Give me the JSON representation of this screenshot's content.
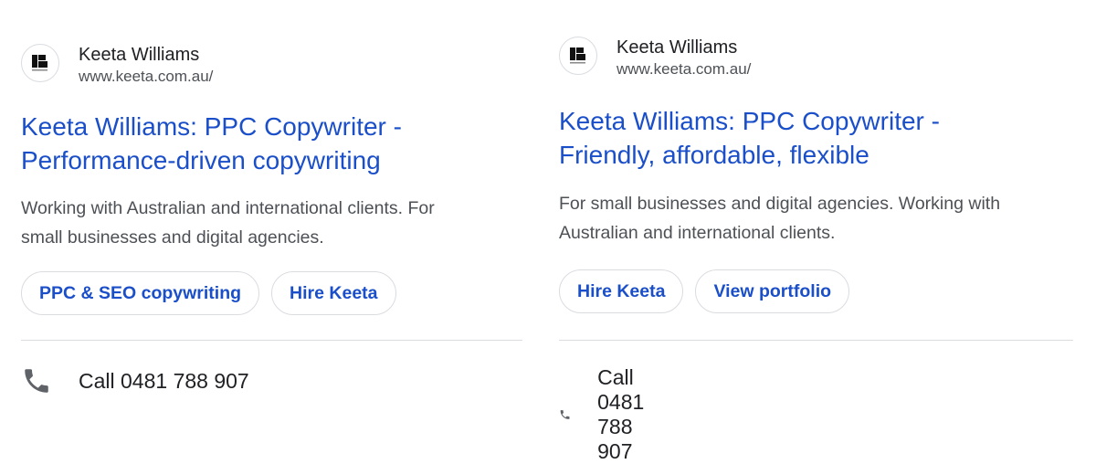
{
  "ads": [
    {
      "advertiser": "Keeta Williams",
      "url": "www.keeta.com.au/",
      "headline_line1": "Keeta Williams: PPC Copywriter -",
      "headline_line2": "Performance-driven copywriting",
      "description_line1": "Working with Australian and international clients. For",
      "description_line2": "small businesses and digital agencies.",
      "sitelinks": [
        "PPC & SEO copywriting",
        "Hire Keeta"
      ],
      "call_label": "Call 0481 788 907",
      "icons": {
        "favicon": "keeta-logo-icon",
        "call": "phone-icon"
      }
    },
    {
      "advertiser": "Keeta Williams",
      "url": "www.keeta.com.au/",
      "headline_line1": "Keeta Williams: PPC Copywriter -",
      "headline_line2": "Friendly, affordable, flexible",
      "description_line1": "For small businesses and digital agencies. Working with",
      "description_line2": "Australian and international clients.",
      "sitelinks": [
        "Hire Keeta",
        "View portfolio"
      ],
      "call_label": "Call 0481 788 907",
      "icons": {
        "favicon": "keeta-logo-icon",
        "call": "phone-icon"
      }
    }
  ],
  "colors": {
    "link": "#1a4fc9",
    "text": "#202124",
    "muted": "#4d5156",
    "border": "#dadce0"
  }
}
